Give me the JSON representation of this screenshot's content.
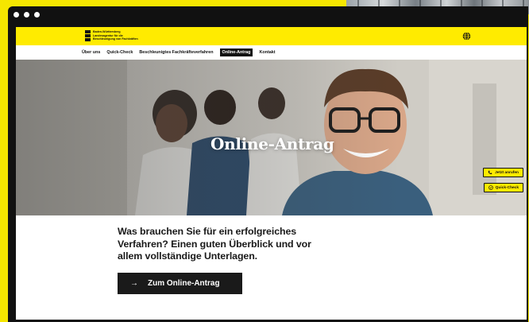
{
  "browser": {
    "dots": 3
  },
  "header": {
    "logo_text": "Baden-Württemberg\nLandesagentur für die\nBeschleunigung von Fachkräften",
    "globe_icon": "globe-icon"
  },
  "nav": {
    "items": [
      "Über uns",
      "Quick-Check",
      "Beschleunigtes Fachkräfteverfahren",
      "Online-Antrag",
      "Kontakt"
    ],
    "active_index": 3
  },
  "hero": {
    "title": "Online-Antrag"
  },
  "side_buttons": {
    "call_label": "Jetzt anrufen",
    "check_label": "Quick-Check"
  },
  "main": {
    "lead": "Was brauchen Sie für ein erfolgreiches Verfahren? Einen guten Überblick und vor allem vollständige Unterlagen.",
    "cta_arrow": "→",
    "cta_label": "Zum Online-Antrag"
  },
  "colors": {
    "accent": "#ffeb00",
    "dark": "#111111",
    "frame": "#f5e600"
  }
}
